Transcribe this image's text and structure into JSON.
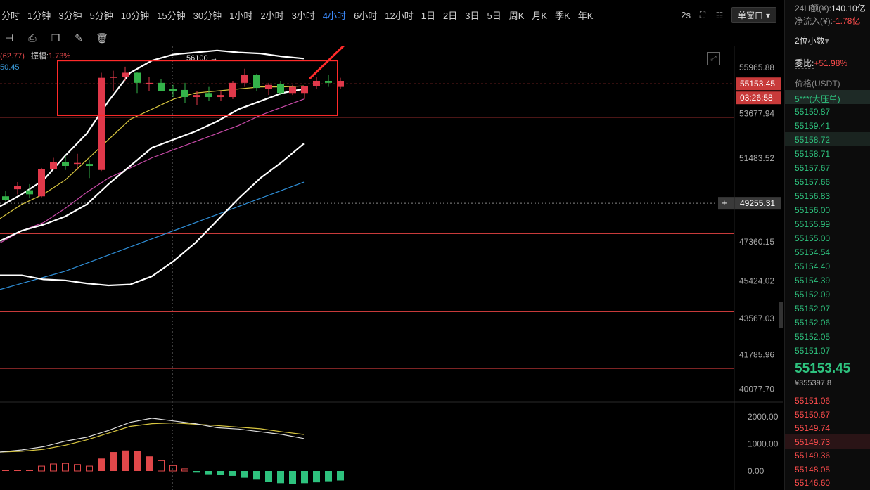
{
  "toolbar": {
    "periods": [
      {
        "label": "分时",
        "active": false
      },
      {
        "label": "1分钟",
        "active": false
      },
      {
        "label": "3分钟",
        "active": false
      },
      {
        "label": "5分钟",
        "active": false
      },
      {
        "label": "10分钟",
        "active": false
      },
      {
        "label": "15分钟",
        "active": false
      },
      {
        "label": "30分钟",
        "active": false
      },
      {
        "label": "1小时",
        "active": false
      },
      {
        "label": "2小时",
        "active": false
      },
      {
        "label": "3小时",
        "active": false
      },
      {
        "label": "4小时",
        "active": true
      },
      {
        "label": "6小时",
        "active": false
      },
      {
        "label": "12小时",
        "active": false
      },
      {
        "label": "1日",
        "active": false
      },
      {
        "label": "2日",
        "active": false
      },
      {
        "label": "3日",
        "active": false
      },
      {
        "label": "5日",
        "active": false
      },
      {
        "label": "周K",
        "active": false
      },
      {
        "label": "月K",
        "active": false
      },
      {
        "label": "季K",
        "active": false
      },
      {
        "label": "年K",
        "active": false
      }
    ],
    "interval": "2s",
    "mode_label": "单窗口"
  },
  "tools": [
    "line-tool-icon",
    "clipboard-icon",
    "copy-icon",
    "edit-icon",
    "trash-icon"
  ],
  "indicators": {
    "amp_value": "(62.77)",
    "amp_label": "振幅:",
    "amp_pct": "1.73%",
    "ma_value": "50.45"
  },
  "chart": {
    "y_labels": [
      "55965.88",
      "53677.94",
      "51483.52",
      "47360.15",
      "45424.02",
      "43567.03",
      "41785.96",
      "40077.70"
    ],
    "price_tag": "55153.45",
    "countdown_tag": "03:26:58",
    "crosshair_tag": "49255.31",
    "annotation": "56100 →",
    "volume_labels": [
      "2000.00",
      "1000.00",
      "0.00"
    ],
    "colors": {
      "up": "#e0384a",
      "down": "#34b34a",
      "box": "#ff2a2a",
      "arrow": "#ff2a2a",
      "bg": "#000000"
    }
  },
  "chart_data": {
    "type": "candlestick",
    "ylim": [
      39300,
      57000
    ],
    "candles": [
      {
        "o": 49600,
        "h": 49850,
        "l": 49350,
        "c": 49400
      },
      {
        "o": 49950,
        "h": 50300,
        "l": 49700,
        "c": 50100
      },
      {
        "o": 49900,
        "h": 50200,
        "l": 49500,
        "c": 49700
      },
      {
        "o": 49600,
        "h": 51000,
        "l": 49550,
        "c": 50950
      },
      {
        "o": 50950,
        "h": 51500,
        "l": 50900,
        "c": 51300
      },
      {
        "o": 51300,
        "h": 51600,
        "l": 50900,
        "c": 51100
      },
      {
        "o": 51200,
        "h": 51700,
        "l": 50900,
        "c": 51250
      },
      {
        "o": 51200,
        "h": 51400,
        "l": 50500,
        "c": 51100
      },
      {
        "o": 50900,
        "h": 55700,
        "l": 50850,
        "c": 55450
      },
      {
        "o": 55450,
        "h": 55800,
        "l": 54800,
        "c": 55500
      },
      {
        "o": 55500,
        "h": 56000,
        "l": 55300,
        "c": 55700
      },
      {
        "o": 55700,
        "h": 55750,
        "l": 54700,
        "c": 55200
      },
      {
        "o": 55200,
        "h": 55500,
        "l": 54800,
        "c": 55200
      },
      {
        "o": 55200,
        "h": 55400,
        "l": 54800,
        "c": 54800
      },
      {
        "o": 54900,
        "h": 55100,
        "l": 54500,
        "c": 54800
      },
      {
        "o": 54850,
        "h": 55200,
        "l": 54200,
        "c": 54500
      },
      {
        "o": 54500,
        "h": 54800,
        "l": 54100,
        "c": 54600
      },
      {
        "o": 54700,
        "h": 55000,
        "l": 54300,
        "c": 54500
      },
      {
        "o": 54500,
        "h": 54800,
        "l": 54300,
        "c": 54600
      },
      {
        "o": 54500,
        "h": 55300,
        "l": 54400,
        "c": 55200
      },
      {
        "o": 55200,
        "h": 55900,
        "l": 55000,
        "c": 55600
      },
      {
        "o": 55600,
        "h": 55650,
        "l": 54800,
        "c": 54950
      },
      {
        "o": 54900,
        "h": 55200,
        "l": 54600,
        "c": 55100
      },
      {
        "o": 55150,
        "h": 55300,
        "l": 54600,
        "c": 54700
      },
      {
        "o": 54700,
        "h": 55100,
        "l": 54600,
        "c": 55000
      },
      {
        "o": 54700,
        "h": 55000,
        "l": 54400,
        "c": 55050
      },
      {
        "o": 55050,
        "h": 55500,
        "l": 54900,
        "c": 55300
      },
      {
        "o": 55300,
        "h": 55600,
        "l": 55000,
        "c": 55200
      },
      {
        "o": 55000,
        "h": 55450,
        "l": 54900,
        "c": 55300
      }
    ],
    "hlines": [
      53500,
      47750,
      43900,
      41100
    ],
    "dashed_line": 55153,
    "crosshair_price": 49255,
    "bands": {
      "upper": [
        49100,
        49700,
        50400,
        51600,
        52700,
        54300,
        55700,
        56300,
        56600,
        56700,
        56800,
        56700,
        56650,
        56500,
        56400
      ],
      "middle": [
        47400,
        47900,
        48200,
        48600,
        49200,
        50200,
        51100,
        52000,
        52400,
        52800,
        53300,
        53900,
        54300,
        54700,
        54900
      ],
      "lower": [
        45700,
        45700,
        45500,
        45450,
        45300,
        45200,
        45250,
        45650,
        46400,
        47300,
        48400,
        49500,
        50500,
        51300,
        52200
      ],
      "ma_yellow": [
        48500,
        49200,
        49700,
        50400,
        51400,
        52400,
        53400,
        53900,
        54400,
        54700,
        54800,
        54900,
        55000,
        55000,
        55050
      ],
      "ma_magenta": [
        47300,
        47900,
        48300,
        49000,
        49800,
        50500,
        51000,
        51500,
        51900,
        52300,
        52700,
        53100,
        53600,
        54000,
        54400
      ],
      "ma_blue": [
        45000,
        45300,
        45600,
        45900,
        46300,
        46700,
        47100,
        47500,
        47900,
        48300,
        48700,
        49100,
        49500,
        49900,
        50300
      ]
    },
    "macd": {
      "dif": [
        700,
        780,
        900,
        1100,
        1250,
        1500,
        1800,
        1950,
        1850,
        1750,
        1600,
        1550,
        1450,
        1350,
        1200
      ],
      "dea": [
        700,
        730,
        800,
        950,
        1150,
        1400,
        1650,
        1750,
        1780,
        1730,
        1680,
        1620,
        1560,
        1450,
        1350
      ],
      "hist": [
        20,
        30,
        50,
        180,
        260,
        280,
        240,
        180,
        460,
        700,
        760,
        740,
        540,
        380,
        200,
        80,
        -60,
        -120,
        -150,
        -180,
        -250,
        -320,
        -400,
        -450,
        -480,
        -450,
        -420,
        -380,
        -350
      ]
    }
  },
  "right_panel": {
    "turnover_label": "24H额(¥):",
    "turnover_value": "140.10亿",
    "inflow_label": "净流入(¥):",
    "inflow_value": "-1.78亿",
    "decimals": "2位小数",
    "ratio_label": "委比:",
    "ratio_value": "+51.98%",
    "price_header": "价格(USDT)",
    "order_name": "5***(大压单)",
    "bids": [
      "55159.87",
      "55159.41",
      "55158.72",
      "55158.71",
      "55157.67",
      "55157.66",
      "55156.83",
      "55156.00",
      "55155.99",
      "55155.00",
      "55154.54",
      "55154.40",
      "55154.39",
      "55152.09",
      "55152.07",
      "55152.06",
      "55152.05",
      "55151.07"
    ],
    "last_price": "55153.45",
    "last_price_cny": "¥355397.8",
    "asks": [
      "55151.06",
      "55150.67",
      "55149.74",
      "55149.73",
      "55149.36",
      "55148.05",
      "55146.60"
    ]
  }
}
